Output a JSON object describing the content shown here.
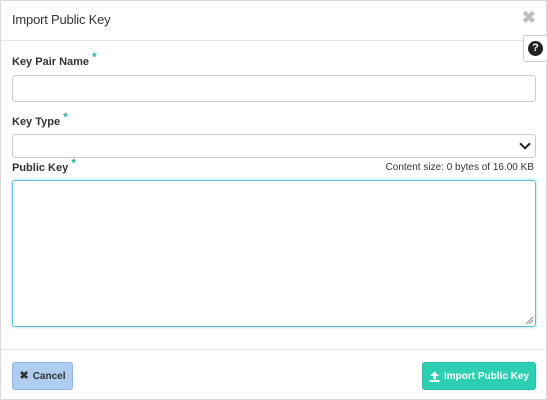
{
  "dialog": {
    "title": "Import Public Key",
    "close_icon": "close-icon",
    "help_icon": "question-circle-icon"
  },
  "form": {
    "key_pair_name": {
      "label": "Key Pair Name",
      "required_mark": "*",
      "value": "",
      "placeholder": ""
    },
    "key_type": {
      "label": "Key Type",
      "required_mark": "*",
      "selected": ""
    },
    "public_key": {
      "label": "Public Key",
      "required_mark": "*",
      "value": "",
      "content_size": "Content size: 0 bytes of 16.00 KB"
    }
  },
  "footer": {
    "cancel_label": "Cancel",
    "cancel_icon": "times-icon",
    "import_label": "Import Public Key",
    "import_icon": "upload-icon"
  },
  "colors": {
    "accent": "#2dcfb3",
    "required": "#26b5a2",
    "cancel_bg": "#aecdf0",
    "focus_border": "#5bc0de"
  }
}
